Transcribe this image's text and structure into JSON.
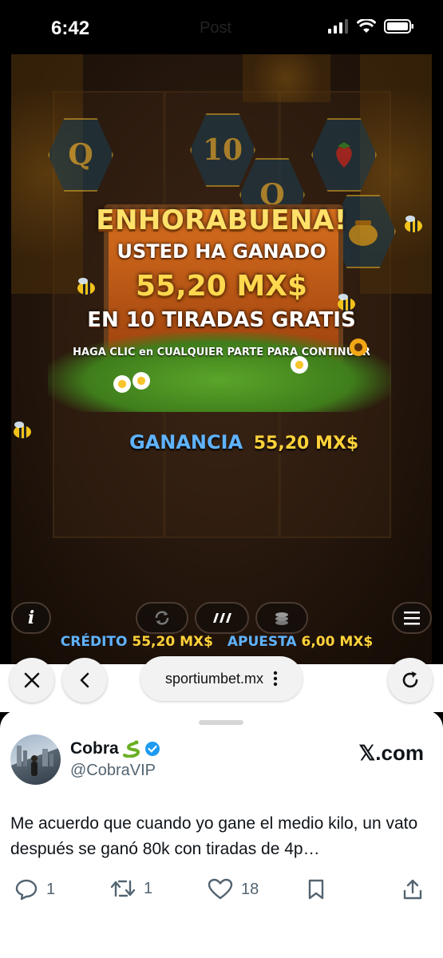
{
  "status": {
    "time": "6:42",
    "faded_title": "Post"
  },
  "game": {
    "symbols": [
      "Q",
      "10",
      "Q"
    ],
    "win_title": "ENHORABUENA!",
    "win_sub": "USTED HA GANADO",
    "win_amount": "55,20 MX$",
    "win_spins": "EN 10 TIRADAS GRATIS",
    "win_hint": "HAGA CLIC en CUALQUIER PARTE PARA CONTINUAR",
    "gain_label": "GANANCIA",
    "gain_value": "55,20 MX$",
    "credit_label": "CRÉDITO",
    "credit_value": "55,20 MX$",
    "bet_label": "APUESTA",
    "bet_value": "6,00 MX$",
    "info_label": "i"
  },
  "browser": {
    "url": "sportiumbet.mx"
  },
  "tweet": {
    "name": "Cobra",
    "handle": "@CobraVIP",
    "brand": "𝕏.com",
    "text": "Me acuerdo que cuando yo gane el medio kilo, un vato después se ganó 80k con tiradas de 4p…",
    "replies": "1",
    "retweets": "1",
    "likes": "18"
  },
  "colors": {
    "accent_blue": "#5fb3ff",
    "accent_gold": "#ffd23a",
    "verified": "#1d9bf0"
  }
}
